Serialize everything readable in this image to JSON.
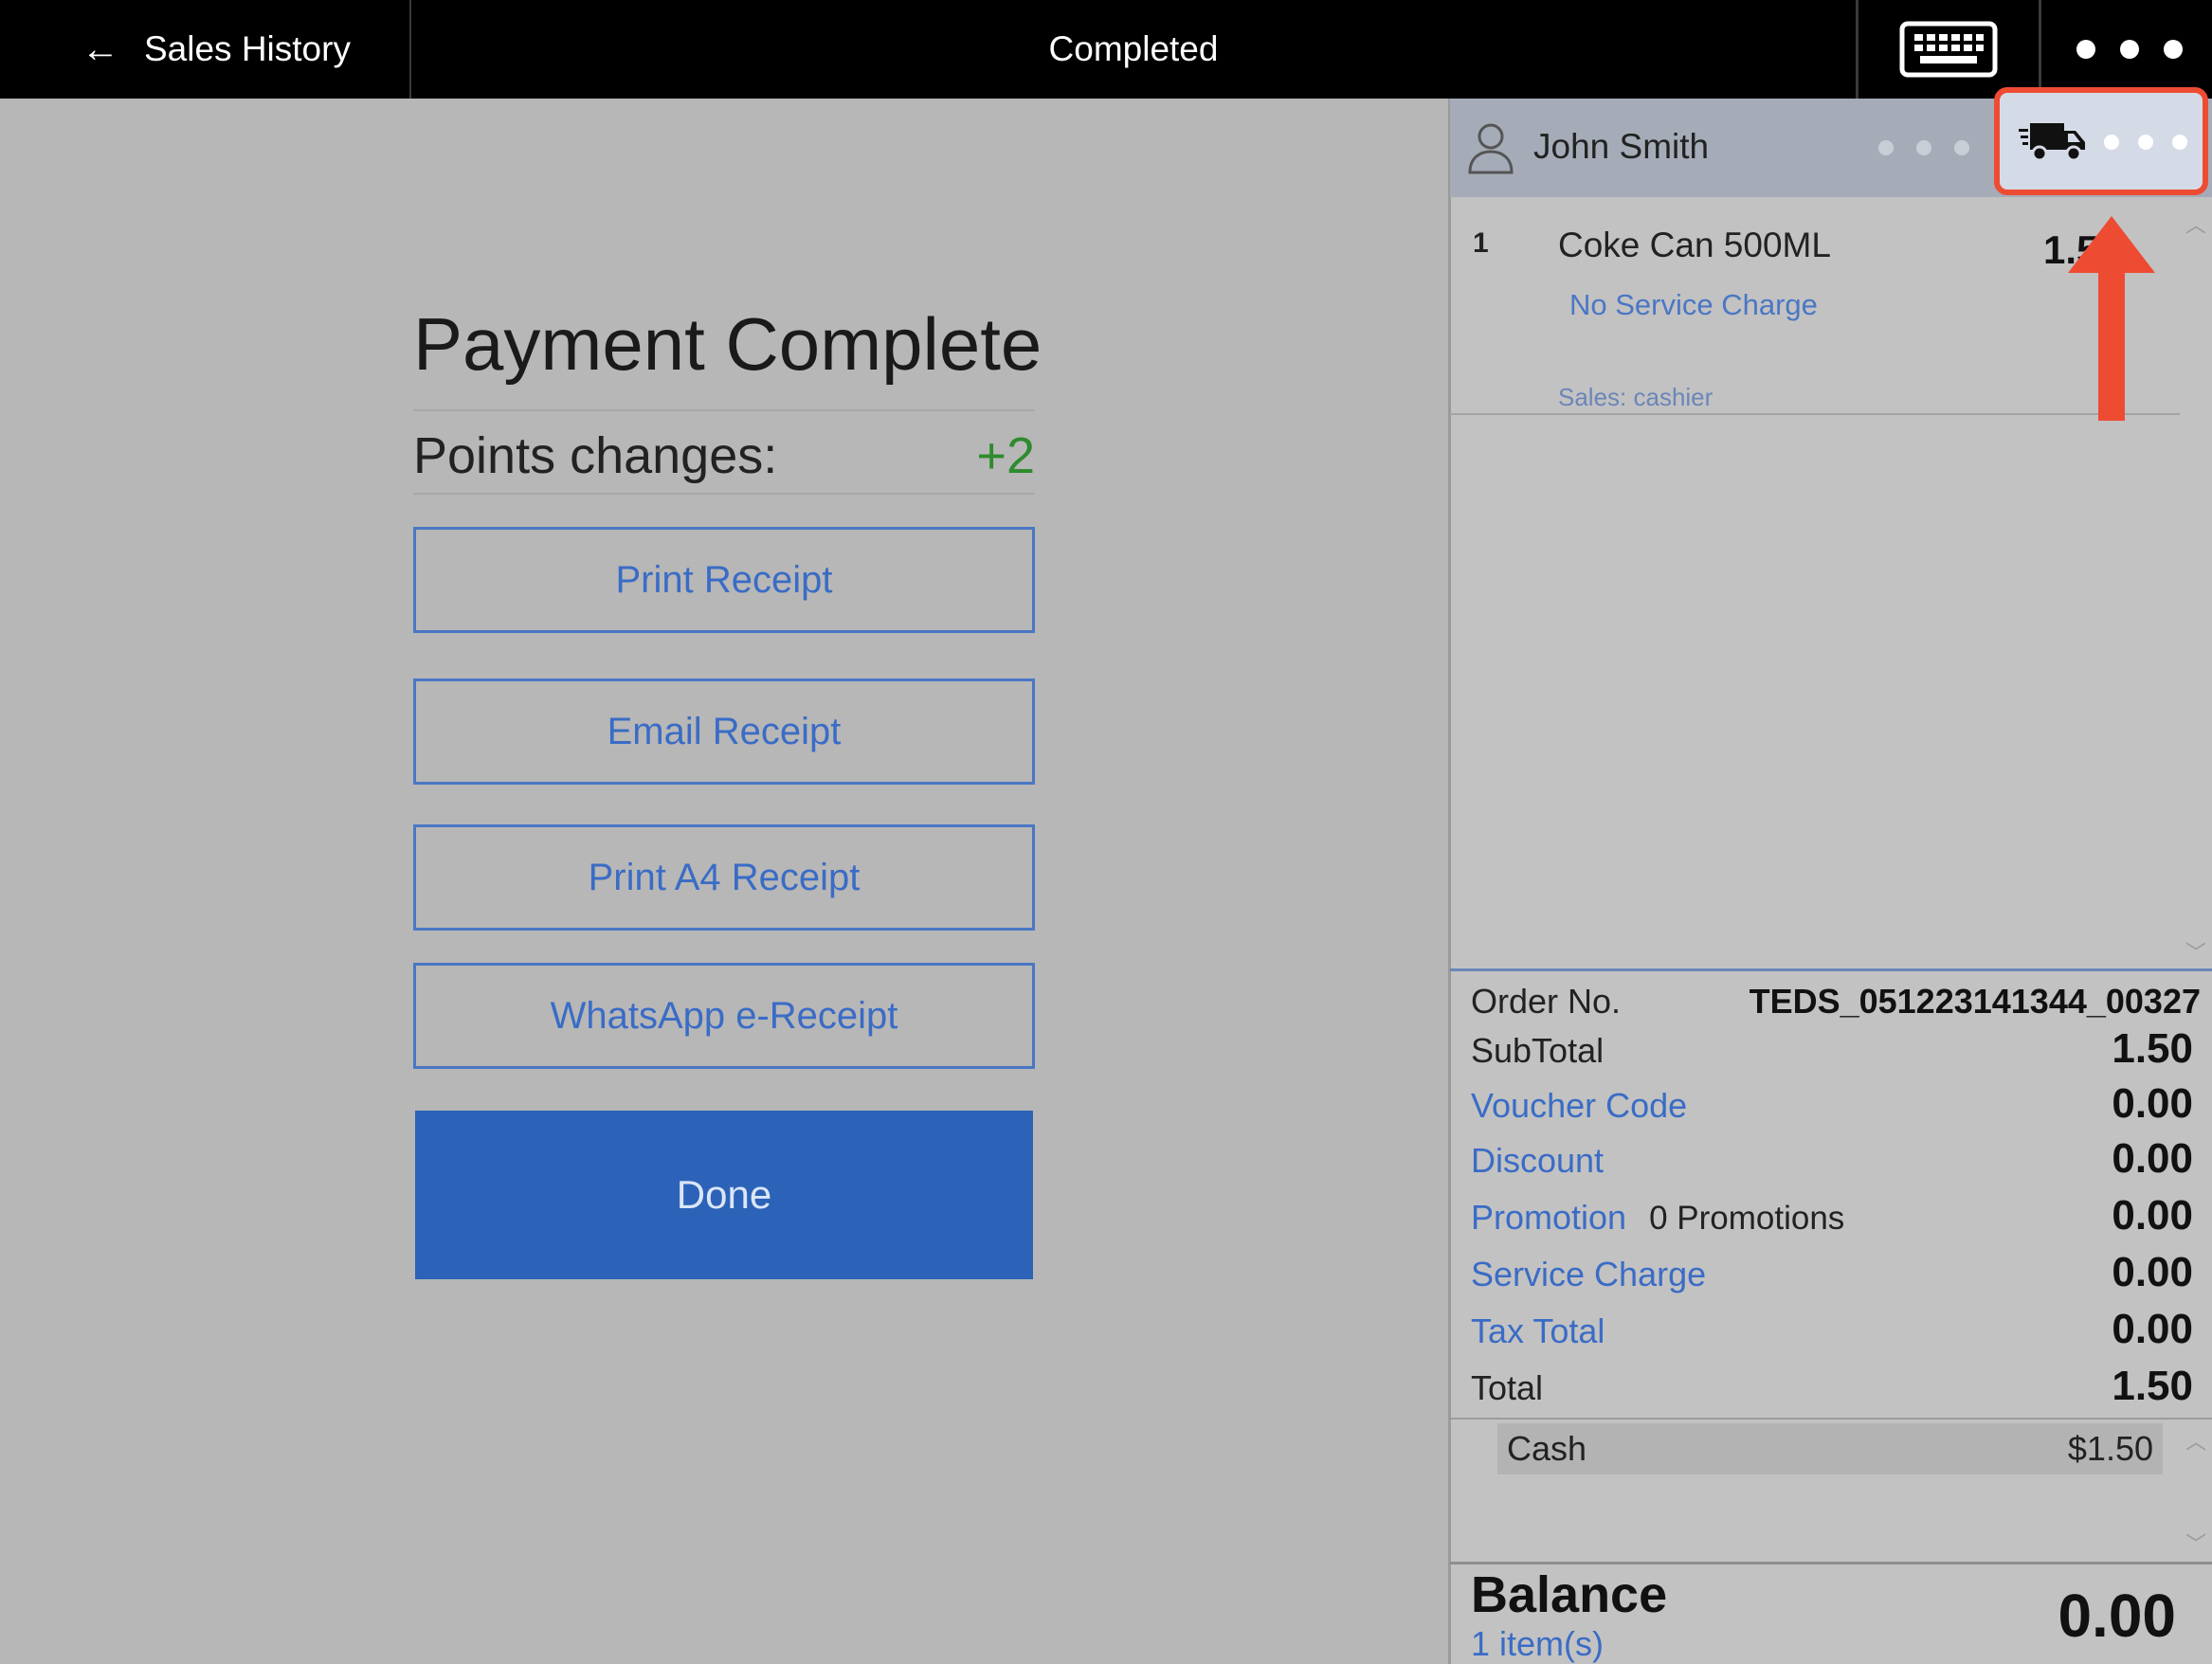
{
  "topbar": {
    "back_label": "Sales History",
    "title": "Completed",
    "back_icon": "arrow-left-icon",
    "keyboard_icon": "keyboard-icon",
    "more_icon": "more-dots-icon"
  },
  "payment": {
    "title": "Payment Complete",
    "points_label": "Points changes:",
    "points_value": "+2",
    "buttons": {
      "print_receipt": "Print Receipt",
      "email_receipt": "Email Receipt",
      "print_a4_receipt": "Print A4 Receipt",
      "whatsapp_receipt": "WhatsApp e-Receipt",
      "done": "Done"
    }
  },
  "customer": {
    "name": "John Smith",
    "icon": "person-icon",
    "delivery_icon": "delivery-truck-icon"
  },
  "cart": {
    "items": [
      {
        "qty": "1",
        "name": "Coke Can 500ML",
        "price": "1.5",
        "note": "No Service Charge",
        "sales": "Sales: cashier"
      }
    ]
  },
  "totals": {
    "order_no_label": "Order No.",
    "order_no_value": "TEDS_051223141344_00327",
    "subtotal_label": "SubTotal",
    "subtotal_value": "1.50",
    "voucher_label": "Voucher Code",
    "voucher_value": "0.00",
    "discount_label": "Discount",
    "discount_value": "0.00",
    "promotion_label": "Promotion",
    "promotion_count": "0 Promotions",
    "promotion_value": "0.00",
    "service_label": "Service Charge",
    "service_value": "0.00",
    "tax_label": "Tax Total",
    "tax_value": "0.00",
    "total_label": "Total",
    "total_value": "1.50"
  },
  "payments": [
    {
      "method": "Cash",
      "amount": "$1.50"
    }
  ],
  "balance": {
    "label": "Balance",
    "items": "1 item(s)",
    "value": "0.00"
  },
  "colors": {
    "accent": "#2c63b8",
    "link": "#3a6cc6",
    "highlight": "#ee4b33",
    "points_positive": "#2e8b2e"
  }
}
